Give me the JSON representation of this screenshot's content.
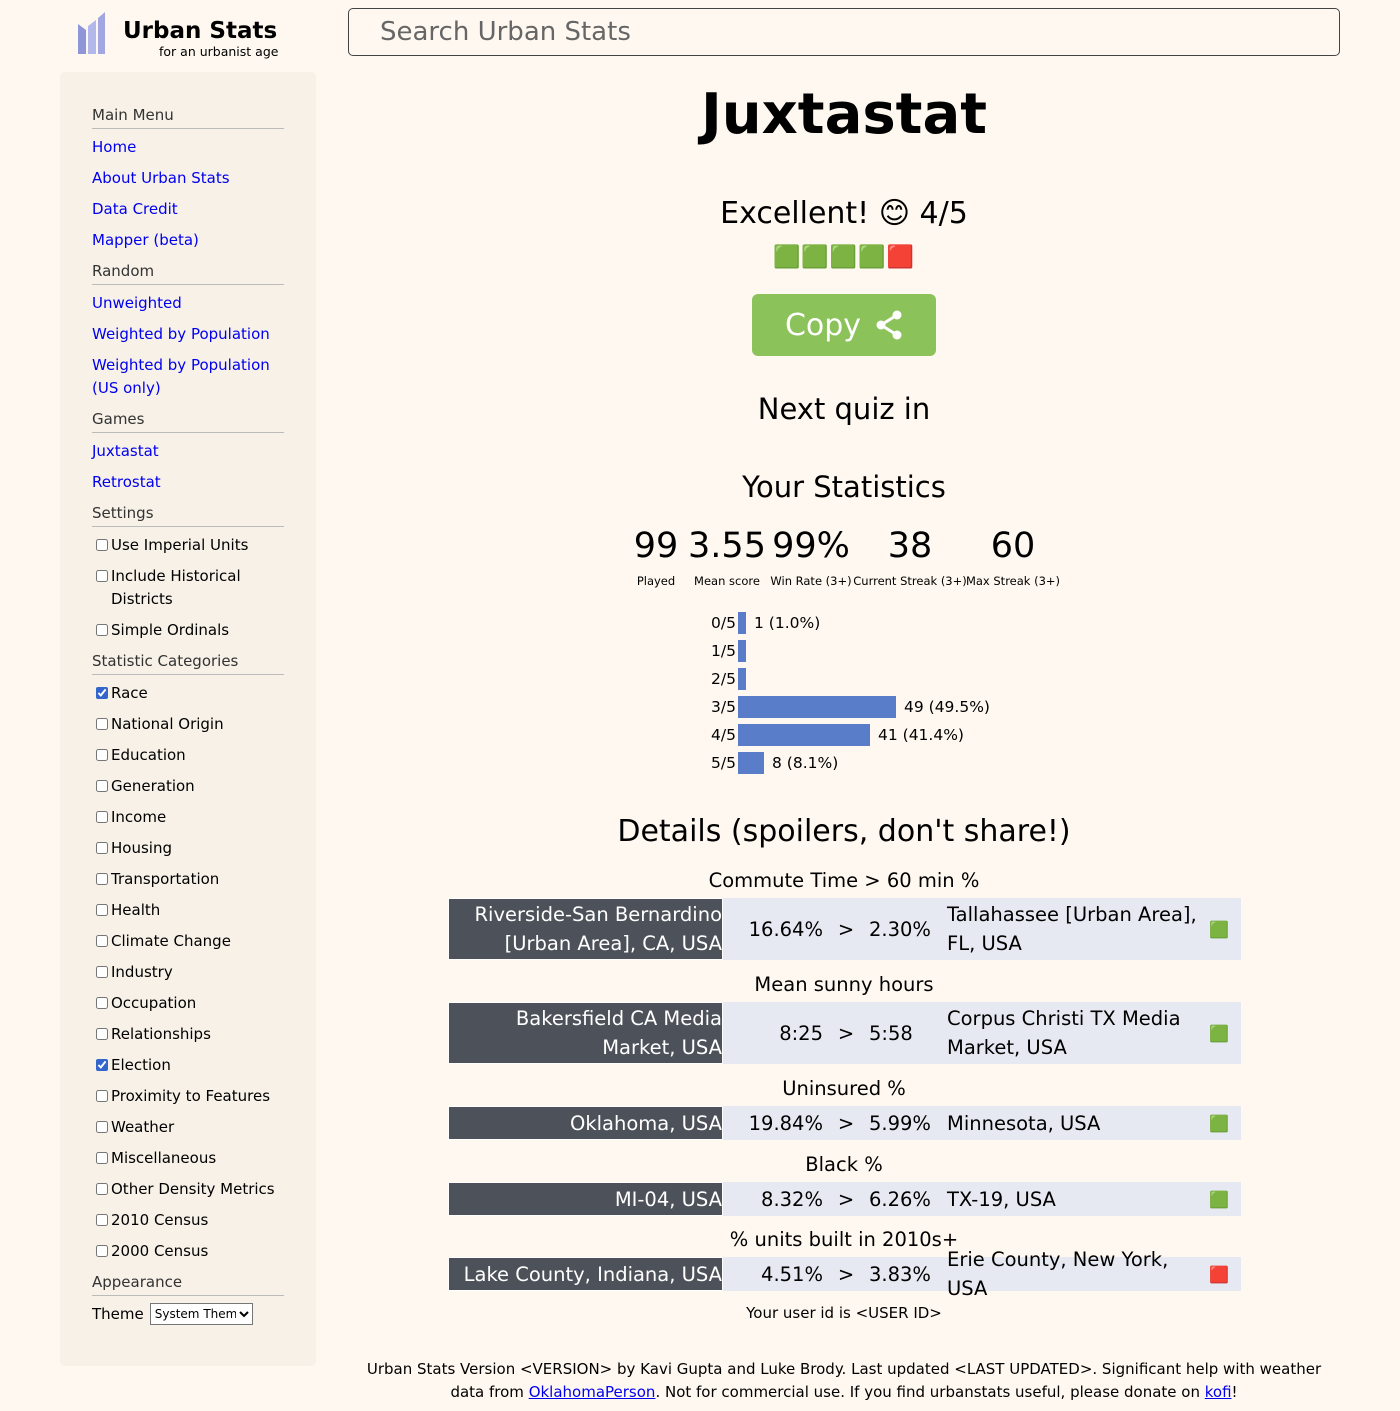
{
  "header": {
    "logo_title": "Urban Stats",
    "logo_subtitle": "for an urbanist age",
    "search_placeholder": "Search Urban Stats"
  },
  "sidebar": {
    "main_menu": {
      "heading": "Main Menu",
      "links": [
        "Home",
        "About Urban Stats",
        "Data Credit",
        "Mapper (beta)"
      ]
    },
    "random": {
      "heading": "Random",
      "links": [
        "Unweighted",
        "Weighted by Population",
        "Weighted by Population (US only)"
      ]
    },
    "games": {
      "heading": "Games",
      "links": [
        "Juxtastat",
        "Retrostat"
      ]
    },
    "settings": {
      "heading": "Settings",
      "options": [
        {
          "label": "Use Imperial Units",
          "checked": false
        },
        {
          "label": "Include Historical Districts",
          "checked": false
        },
        {
          "label": "Simple Ordinals",
          "checked": false
        }
      ]
    },
    "categories": {
      "heading": "Statistic Categories",
      "options": [
        {
          "label": "Race",
          "checked": true
        },
        {
          "label": "National Origin",
          "checked": false
        },
        {
          "label": "Education",
          "checked": false
        },
        {
          "label": "Generation",
          "checked": false
        },
        {
          "label": "Income",
          "checked": false
        },
        {
          "label": "Housing",
          "checked": false
        },
        {
          "label": "Transportation",
          "checked": false
        },
        {
          "label": "Health",
          "checked": false
        },
        {
          "label": "Climate Change",
          "checked": false
        },
        {
          "label": "Industry",
          "checked": false
        },
        {
          "label": "Occupation",
          "checked": false
        },
        {
          "label": "Relationships",
          "checked": false
        },
        {
          "label": "Election",
          "checked": true
        },
        {
          "label": "Proximity to Features",
          "checked": false
        },
        {
          "label": "Weather",
          "checked": false
        },
        {
          "label": "Miscellaneous",
          "checked": false
        },
        {
          "label": "Other Density Metrics",
          "checked": false
        },
        {
          "label": "2010 Census",
          "checked": false
        },
        {
          "label": "2000 Census",
          "checked": false
        }
      ]
    },
    "appearance": {
      "heading": "Appearance",
      "theme_label": "Theme",
      "theme_value": "System Theme"
    }
  },
  "main": {
    "title": "Juxtastat",
    "result": "Excellent! 😊 4/5",
    "emoji_row": "🟩🟩🟩🟩🟥",
    "copy_label": "Copy",
    "next_quiz": "Next quiz in",
    "stats_heading": "Your Statistics",
    "stats": [
      {
        "value": "99",
        "label": "Played"
      },
      {
        "value": "3.55",
        "label": "Mean score"
      },
      {
        "value": "99%",
        "label": "Win Rate (3+)"
      },
      {
        "value": "38",
        "label": "Current Streak (3+)"
      },
      {
        "value": "60",
        "label": "Max Streak (3+)"
      }
    ],
    "distribution": [
      {
        "label": "0/5",
        "count": 1,
        "text": "1 (1.0%)"
      },
      {
        "label": "1/5",
        "count": 0,
        "text": ""
      },
      {
        "label": "2/5",
        "count": 0,
        "text": ""
      },
      {
        "label": "3/5",
        "count": 49,
        "text": "49 (49.5%)"
      },
      {
        "label": "4/5",
        "count": 41,
        "text": "41 (41.4%)"
      },
      {
        "label": "5/5",
        "count": 8,
        "text": "8 (8.1%)"
      }
    ],
    "details_heading": "Details (spoilers, don't share!)",
    "questions": [
      {
        "stat": "Commute Time > 60 min %",
        "left": "Riverside-San Bernardino [Urban Area], CA, USA",
        "v1": "16.64%",
        "op": ">",
        "v2": "2.30%",
        "right": "Tallahassee [Urban Area], FL, USA",
        "mark": "🟩"
      },
      {
        "stat": "Mean sunny hours",
        "left": "Bakersfield CA Media Market, USA",
        "v1": "8:25",
        "op": ">",
        "v2": "5:58",
        "right": "Corpus Christi TX Media Market, USA",
        "mark": "🟩"
      },
      {
        "stat": "Uninsured %",
        "left": "Oklahoma, USA",
        "v1": "19.84%",
        "op": ">",
        "v2": "5.99%",
        "right": "Minnesota, USA",
        "mark": "🟩"
      },
      {
        "stat": "Black %",
        "left": "MI-04, USA",
        "v1": "8.32%",
        "op": ">",
        "v2": "6.26%",
        "right": "TX-19, USA",
        "mark": "🟩"
      },
      {
        "stat": "% units built in 2010s+",
        "left": "Lake County, Indiana, USA",
        "v1": "4.51%",
        "op": ">",
        "v2": "3.83%",
        "right": "Erie County, New York, USA",
        "mark": "🟥"
      }
    ],
    "user_id": "Your user id is <USER ID>"
  },
  "footer": {
    "text1": "Urban Stats Version <VERSION> by Kavi Gupta and Luke Brody. Last updated <LAST UPDATED>. Significant help with weather data from ",
    "link1": "OklahomaPerson",
    "text2": ". Not for commercial use. If you find urbanstats useful, please donate on ",
    "link2": "kofi",
    "text3": "!"
  },
  "colors": {
    "background": "#fff8f0",
    "sidebar": "#f7f1e8",
    "link": "#0000ee",
    "copy_button": "#8bc25a",
    "bar": "#5a7dc9",
    "left_cell": "#4d525a",
    "row_bg": "#e6e9f1"
  }
}
